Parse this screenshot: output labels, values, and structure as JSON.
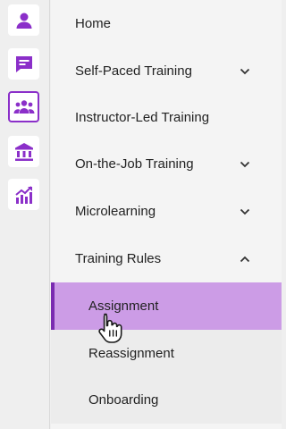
{
  "colors": {
    "accent": "#8b2fc9",
    "selected_bg": "#cc9ce6",
    "selected_border": "#7a2bb0",
    "menu_bg": "#f4f4f4",
    "sub_bg": "#ececec"
  },
  "rail": {
    "items": [
      {
        "icon": "user-icon",
        "active": false
      },
      {
        "icon": "chat-icon",
        "active": false
      },
      {
        "icon": "group-icon",
        "active": true
      },
      {
        "icon": "institution-icon",
        "active": false
      },
      {
        "icon": "analytics-chart-icon",
        "active": false
      }
    ]
  },
  "menu": {
    "items": [
      {
        "label": "Home",
        "chevron": "none"
      },
      {
        "label": "Self-Paced Training",
        "chevron": "down"
      },
      {
        "label": "Instructor-Led Training",
        "chevron": "none"
      },
      {
        "label": "On-the-Job Training",
        "chevron": "down"
      },
      {
        "label": "Microlearning",
        "chevron": "down"
      },
      {
        "label": "Training Rules",
        "chevron": "up"
      }
    ],
    "sub_items": [
      {
        "label": "Assignment",
        "selected": true
      },
      {
        "label": "Reassignment",
        "selected": false
      },
      {
        "label": "Onboarding",
        "selected": false
      }
    ]
  }
}
